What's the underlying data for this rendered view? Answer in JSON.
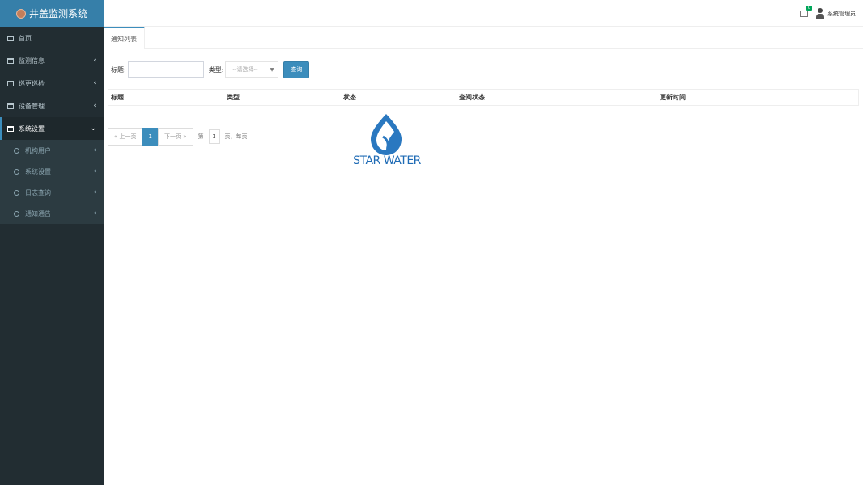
{
  "app": {
    "title": "井盖监测系统"
  },
  "sidebar": {
    "items": [
      {
        "label": "首页",
        "icon": "table-icon",
        "has_chevron": false
      },
      {
        "label": "监测信息",
        "icon": "table-icon",
        "has_chevron": true
      },
      {
        "label": "巡更巡检",
        "icon": "table-icon",
        "has_chevron": true
      },
      {
        "label": "设备管理",
        "icon": "table-icon",
        "has_chevron": true
      },
      {
        "label": "系统设置",
        "icon": "table-icon",
        "has_chevron": true,
        "active": true
      }
    ],
    "sub_items": [
      {
        "label": "机构用户"
      },
      {
        "label": "系统设置"
      },
      {
        "label": "日志查询"
      },
      {
        "label": "通知通告"
      }
    ],
    "chevron_left": "‹",
    "chevron_down": "⌄"
  },
  "header": {
    "mail_badge": "0",
    "user_name": "系统管理员"
  },
  "tabs": [
    {
      "label": "通知列表"
    }
  ],
  "filters": {
    "title_label": "标题:",
    "title_value": "",
    "type_label": "类型:",
    "type_selected": "--请选择--",
    "query_button": "查询"
  },
  "table": {
    "columns": [
      "标题",
      "类型",
      "状态",
      "查阅状态",
      "更新时间"
    ],
    "rows": []
  },
  "pager": {
    "prev": "« 上一页",
    "current": "1",
    "next": "下一页 »",
    "info_prefix": "第",
    "page_value": "1",
    "info_suffix": "页，每页"
  },
  "watermark": {
    "text": "STAR WATER"
  },
  "colors": {
    "accent": "#3c8dbc",
    "sidebar_bg": "#222d32",
    "logo_bg": "#367fa9",
    "badge": "#00a65a"
  }
}
